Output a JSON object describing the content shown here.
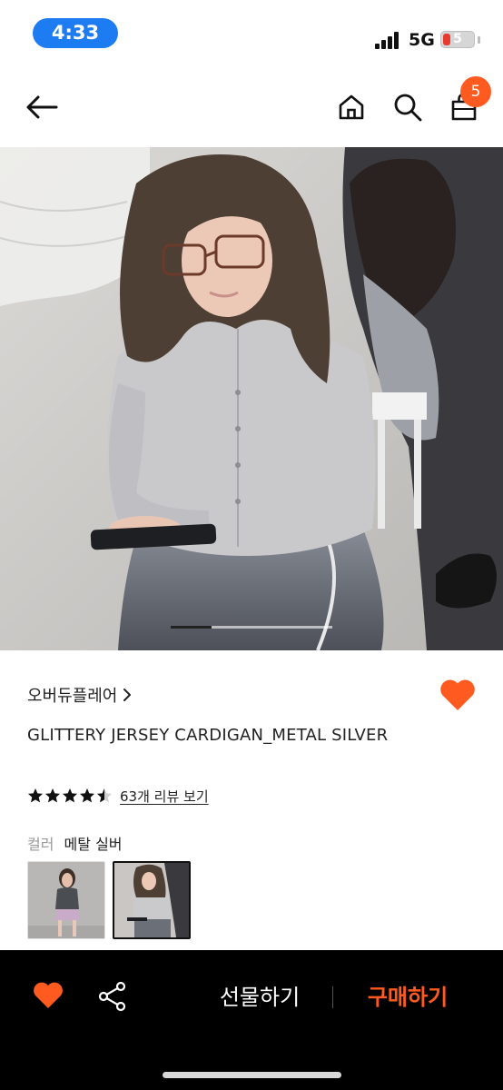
{
  "status_bar": {
    "time": "4:33",
    "network": "5G",
    "battery": "5"
  },
  "nav": {
    "cart_count": "5"
  },
  "gallery": {
    "active_index": 1,
    "total": 4
  },
  "product": {
    "brand": "오버듀플레어",
    "title": "GLITTERY JERSEY CARDIGAN_METAL SILVER",
    "rating": 4.5,
    "review_link": "63개 리뷰 보기",
    "color_label": "컬러",
    "color_value": "메탈 실버"
  },
  "bottom_bar": {
    "gift_label": "선물하기",
    "buy_label": "구매하기"
  },
  "colors": {
    "accent": "#ff5a1f",
    "status_pill": "#1e7cf2",
    "bar_bg": "#000000"
  }
}
